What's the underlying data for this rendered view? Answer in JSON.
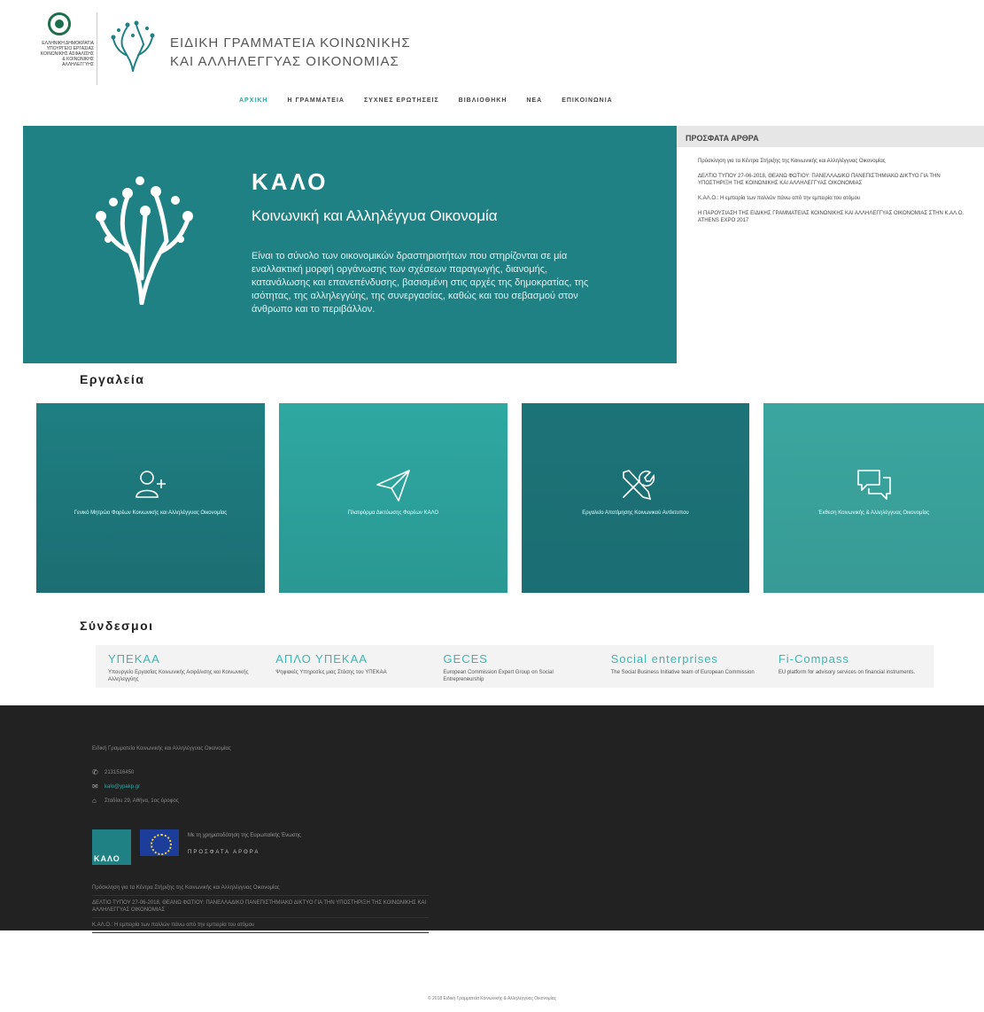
{
  "gov_logo": {
    "lines": [
      "ΕΛΛΗΝΙΚΗ ΔΗΜΟΚΡΑΤΙΑ",
      "ΥΠΟΥΡΓΕΙΟ ΕΡΓΑΣΙΑΣ",
      "ΚΟΙΝΩΝΙΚΗΣ ΑΣΦΑΛΙΣΗΣ",
      "& ΚΟΙΝΩΝΙΚΗΣ",
      "ΑΛΛΗΛΕΓΓΥΗΣ"
    ]
  },
  "site_title": {
    "line1": "ΕΙΔΙΚΗ ΓΡΑΜΜΑΤΕΙΑ ΚΟΙΝΩΝΙΚΗΣ",
    "line2": "ΚΑΙ ΑΛΛΗΛΕΓΓΥΑΣ ΟΙΚΟΝΟΜΙΑΣ"
  },
  "nav": {
    "items": [
      "ΑΡΧΙΚΗ",
      "Η ΓΡΑΜΜΑΤΕΙΑ",
      "ΣΥΧΝΕΣ ΕΡΩΤΗΣΕΙΣ",
      "ΒΙΒΛΙΟΘΗΚΗ",
      "ΝΕΑ",
      "ΕΠΙΚΟΙΝΩΝΙΑ"
    ]
  },
  "hero": {
    "title": "ΚΑΛΟ",
    "subtitle": "Κοινωνική και Αλληλέγγυα Οικονομία",
    "text": "Είναι το σύνολο των οικονομικών δραστηριοτήτων που στηρίζονται σε μία εναλλακτική μορφή οργάνωσης των σχέσεων παραγωγής, διανομής, κατανάλωσης και επανεπένδυσης, βασισμένη στις αρχές της δημοκρατίας, της ισότητας, της αλληλεγγύης, της συνεργασίας, καθώς και του σεβασμού στον άνθρωπο και το περιβάλλον."
  },
  "recent": {
    "title": "ΠΡΟΣΦΑΤΑ ΑΡΘΡΑ",
    "items": [
      "Πρόσκληση για τα Κέντρα Στήριξης της Κοινωνικής και Αλληλέγγυας Οικονομίας",
      "ΔΕΛΤΙΟ ΤΥΠΟΥ 27-06-2018, ΘΕΑΝΩ ΦΩΤΙΟΥ: ΠΑΝΕΛΛΑΔΙΚΟ ΠΑΝΕΠΙΣΤΗΜΙΑΚΟ ΔΙΚΤΥΟ ΓΙΑ ΤΗΝ ΥΠΟΣΤΗΡΙΞΗ ΤΗΣ ΚΟΙΝΩΝΙΚΗΣ ΚΑΙ ΑΛΛΗΛΕΓΓΥΑΣ ΟΙΚΟΝΟΜΙΑΣ",
      "Κ.ΑΛ.Ο.: Η εμπειρία των πολλών πάνω από την εμπειρία του ατόμου",
      "Η ΠΑΡΟΥΣΙΑΣΗ ΤΗΣ ΕΙΔΙΚΗΣ ΓΡΑΜΜΑΤΕΙΑΣ ΚΟΙΝΩΝΙΚΗΣ ΚΑΙ ΑΛΛΗΛΕΓΓΥΑΣ ΟΙΚΟΝΟΜΙΑΣ ΣΤΗΝ Κ.ΑΛ.Ο. ATHENS EXPO 2017"
    ]
  },
  "tools": {
    "title": "Εργαλεία",
    "items": [
      {
        "label": "Γενικό Μητρώο Φορέων Κοινωνικής και Αλληλέγγυας Οικονομίας",
        "icon": "add-user-icon"
      },
      {
        "label": "Πλατφόρμα Δικτύωσης Φορέων ΚΑΛΟ",
        "icon": "paper-plane-icon"
      },
      {
        "label": "Εργαλείο Αποτίμησης Κοινωνικού Αντίκτυπου",
        "icon": "tools-icon"
      },
      {
        "label": "Έκθεση Κοινωνικής & Αλληλέγγυας Οικονομίας",
        "icon": "chat-icon"
      }
    ]
  },
  "links": {
    "title": "Σύνδεσμοι",
    "items": [
      {
        "title": "ΥΠΕΚΑΑ",
        "desc": "Υπουργείο Εργασίας Κοινωνικής Ασφάλισης και Κοινωνικής Αλληλεγγύης"
      },
      {
        "title": "ΑΠΛΟ ΥΠΕΚΑΑ",
        "desc": "Ψηφιακές Υπηρεσίες μιας Στάσης του ΥΠΕΚΑΑ"
      },
      {
        "title": "GECES",
        "desc": "European Commission Expert Group on Social Entrepreneurship"
      },
      {
        "title": "Social enterprises",
        "desc": "The Social Business Initiative team of European Commission"
      },
      {
        "title": "Fi-Compass",
        "desc": "EU platform for advisory services on financial instruments."
      }
    ]
  },
  "footer": {
    "org_name": "Ειδική Γραμματεία Κοινωνικής και Αλληλέγγυας Οικονομίας",
    "phone": "2131516450",
    "email": "kalo@ypakp.gr",
    "address": "Σταδίου 29, Αθήνα, 1ος όροφος",
    "kalo_logo_text": "ΚΑΛΟ",
    "support_text": "Με τη χρηματοδότηση της Ευρωπαϊκής Ένωσης",
    "recent_title": "ΠΡΟΣΦΑΤΑ ΑΡΘΡΑ",
    "recent_items": [
      "Πρόσκληση για τα Κέντρα Στήριξης της Κοινωνικής και Αλληλέγγυας Οικονομίας",
      "ΔΕΛΤΙΟ ΤΥΠΟΥ 27-06-2018, ΘΕΑΝΩ ΦΩΤΙΟΥ: ΠΑΝΕΛΛΑΔΙΚΟ ΠΑΝΕΠΙΣΤΗΜΙΑΚΟ ΔΙΚΤΥΟ ΓΙΑ ΤΗΝ ΥΠΟΣΤΗΡΙΞΗ ΤΗΣ ΚΟΙΝΩΝΙΚΗΣ ΚΑΙ ΑΛΛΗΛΕΓΓΥΑΣ ΟΙΚΟΝΟΜΙΑΣ",
      "Κ.ΑΛ.Ο.: Η εμπειρία των πολλών πάνω από την εμπειρία του ατόμου"
    ]
  },
  "copyright": "© 2018 Ειδική Γραμματεία Κοινωνικής & Αλληλέγγυας Οικονομίας",
  "colors": {
    "teal": "#1f8184",
    "accent": "#2aa7a3",
    "footer_bg": "#222222"
  }
}
